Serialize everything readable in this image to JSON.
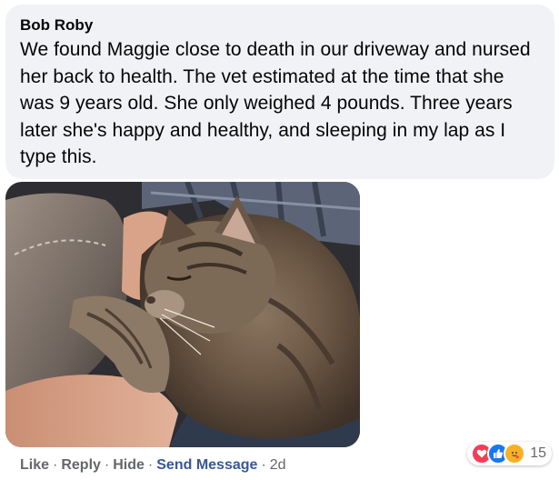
{
  "comment": {
    "author": "Bob Roby",
    "text": "We found Maggie close to death in our driveway and nursed her back to health. The vet estimated at the time that she was 9 years old. She only weighed 4 pounds. Three years later she's happy and healthy, and sleeping in my lap as I type this."
  },
  "actions": {
    "like": "Like",
    "reply": "Reply",
    "hide": "Hide",
    "send_message": "Send Message",
    "timestamp": "2d",
    "separator": "·"
  },
  "reactions": {
    "icons": [
      "love-icon",
      "like-icon",
      "care-icon"
    ],
    "count": "15",
    "colors": {
      "love": "#f33e58",
      "like": "#1877f2",
      "care": "#f7b125"
    }
  },
  "colors": {
    "bubble_bg": "#f0f2f5",
    "secondary_text": "#65676b",
    "link": "#385898"
  }
}
